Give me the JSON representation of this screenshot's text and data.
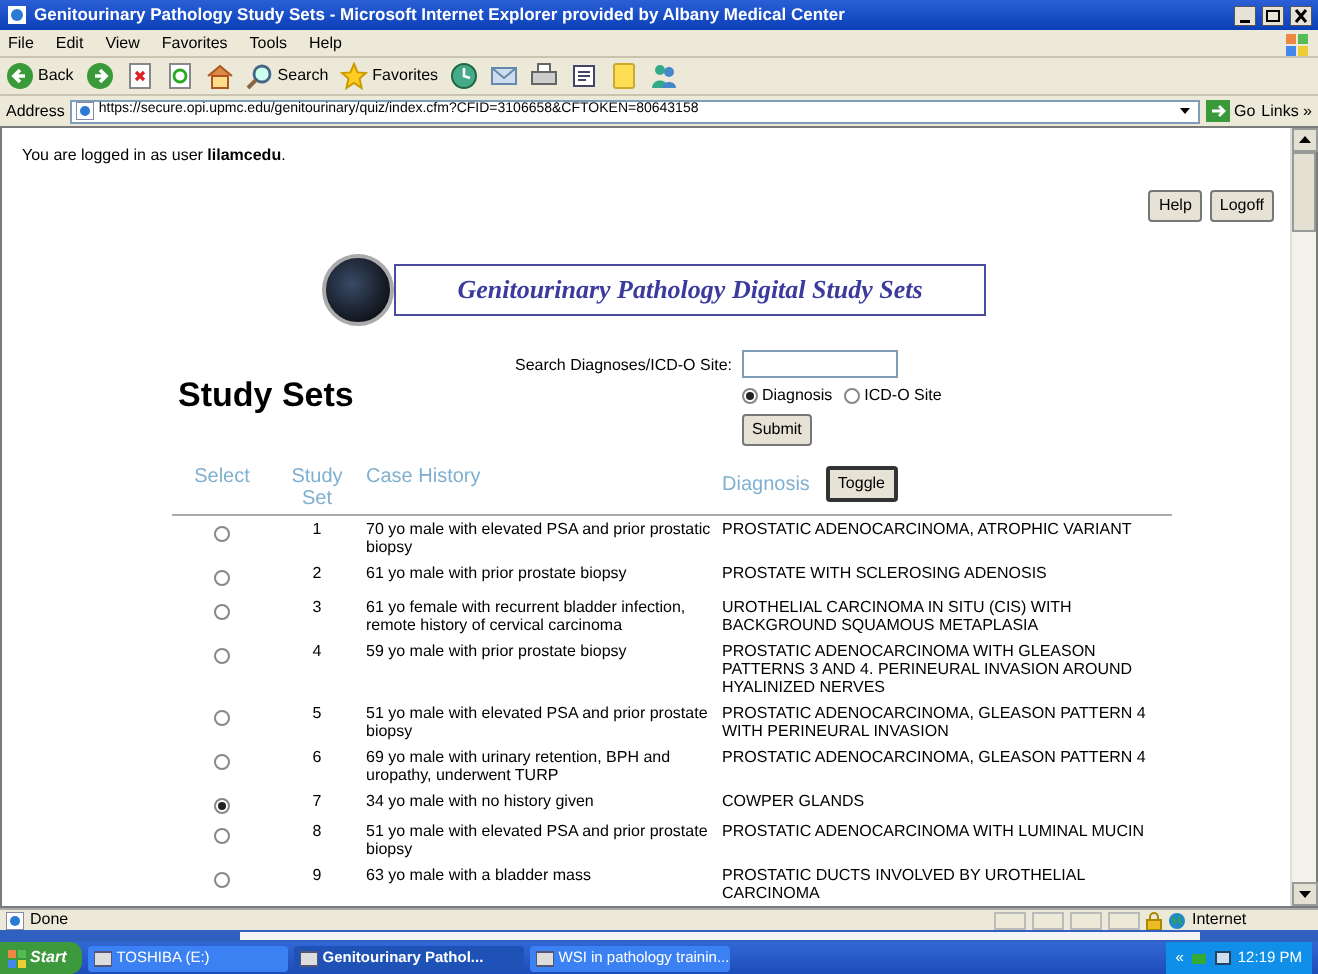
{
  "window": {
    "title": "Genitourinary Pathology Study Sets - Microsoft Internet Explorer provided by Albany Medical Center"
  },
  "menu": [
    "File",
    "Edit",
    "View",
    "Favorites",
    "Tools",
    "Help"
  ],
  "toolbar": [
    {
      "kind": "back",
      "label": "Back"
    },
    {
      "kind": "forward"
    },
    {
      "kind": "stop"
    },
    {
      "kind": "refresh"
    },
    {
      "kind": "home"
    },
    {
      "kind": "search",
      "label": "Search"
    },
    {
      "kind": "favorites",
      "label": "Favorites"
    },
    {
      "kind": "history"
    },
    {
      "kind": "mail"
    },
    {
      "kind": "print"
    },
    {
      "kind": "edit"
    },
    {
      "kind": "note"
    },
    {
      "kind": "messenger"
    }
  ],
  "address": {
    "label": "Address",
    "url": "https://secure.opi.upmc.edu/genitourinary/quiz/index.cfm?CFID=3106658&CFTOKEN=80643158",
    "go": "Go",
    "links": "Links »"
  },
  "page": {
    "login_text": "You are logged in as user ",
    "login_user": "lilamcedu",
    "login_end": ".",
    "buttons": [
      "Help",
      "Logoff"
    ],
    "banner": "Genitourinary Pathology Digital Study Sets",
    "heading": "Study Sets",
    "search_label": "Search Diagnoses/ICD-O Site:",
    "search_options": [
      {
        "label": "Diagnosis",
        "selected": true
      },
      {
        "label": "ICD-O Site",
        "selected": false
      }
    ],
    "submit": "Submit",
    "columns": [
      "Select",
      "Study Set",
      "Case History",
      "Diagnosis"
    ],
    "toggle": "Toggle",
    "rows": [
      {
        "set": "1",
        "history": "70 yo male with elevated PSA and prior prostatic biopsy",
        "diagnosis": "PROSTATIC ADENOCARCINOMA, ATROPHIC VARIANT",
        "selected": false
      },
      {
        "set": "2",
        "history": "61 yo male with prior prostate biopsy",
        "diagnosis": "PROSTATE WITH SCLEROSING ADENOSIS",
        "selected": false
      },
      {
        "set": "3",
        "history": "61 yo female with recurrent bladder infection, remote history of cervical carcinoma",
        "diagnosis": "UROTHELIAL CARCINOMA IN SITU (CIS) WITH BACKGROUND SQUAMOUS METAPLASIA",
        "selected": false
      },
      {
        "set": "4",
        "history": "59 yo male with prior prostate biopsy",
        "diagnosis": "PROSTATIC ADENOCARCINOMA WITH GLEASON PATTERNS 3 AND 4. PERINEURAL INVASION AROUND HYALINIZED NERVES",
        "selected": false
      },
      {
        "set": "5",
        "history": "51 yo male with elevated PSA and prior prostate biopsy",
        "diagnosis": "PROSTATIC ADENOCARCINOMA, GLEASON PATTERN 4 WITH PERINEURAL INVASION",
        "selected": false
      },
      {
        "set": "6",
        "history": "69 yo male with urinary retention, BPH and uropathy, underwent TURP",
        "diagnosis": "PROSTATIC ADENOCARCINOMA, GLEASON PATTERN 4",
        "selected": false
      },
      {
        "set": "7",
        "history": "34 yo male with no history given",
        "diagnosis": "COWPER GLANDS",
        "selected": true
      },
      {
        "set": "8",
        "history": "51 yo male with elevated PSA and prior prostate biopsy",
        "diagnosis": "PROSTATIC ADENOCARCINOMA WITH LUMINAL MUCIN",
        "selected": false
      },
      {
        "set": "9",
        "history": "63 yo male with a bladder mass",
        "diagnosis": "PROSTATIC DUCTS INVOLVED BY UROTHELIAL CARCINOMA",
        "selected": false
      }
    ]
  },
  "status_bar": {
    "text": "Done",
    "zone": "Internet"
  },
  "taskbar": {
    "start": "Start",
    "items": [
      {
        "label": "TOSHIBA (E:)",
        "selected": false
      },
      {
        "label": "Genitourinary Pathol...",
        "selected": true
      },
      {
        "label": "WSI in pathology trainin...",
        "selected": false
      }
    ],
    "tray_expand": "«",
    "clock": "12:19 PM"
  }
}
